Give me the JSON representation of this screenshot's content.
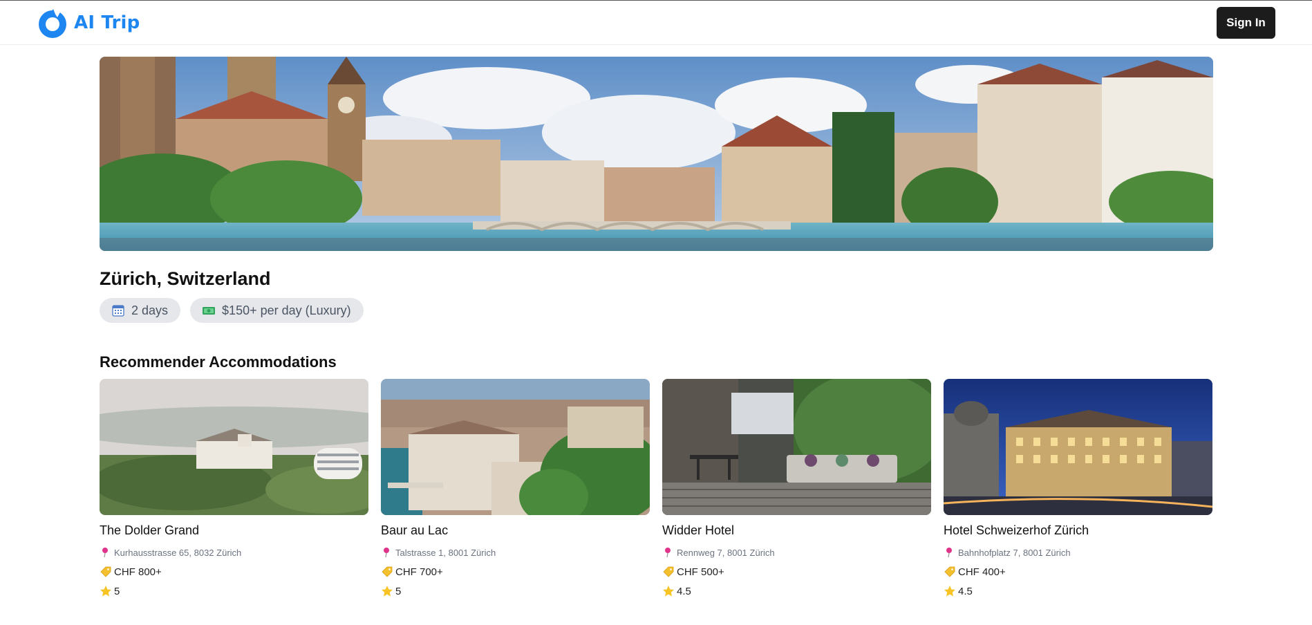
{
  "app": {
    "name": "AI Trip",
    "accent": "#1e86f0",
    "signin_label": "Sign In"
  },
  "destination": {
    "title": "Zürich, Switzerland",
    "duration": "2 days",
    "budget": "$150+ per day (Luxury)"
  },
  "accommodations": {
    "heading": "Recommender Accommodations",
    "items": [
      {
        "name": "The Dolder Grand",
        "address": "Kurhausstrasse 65, 8032 Zürich",
        "price": "CHF 800+",
        "rating": "5"
      },
      {
        "name": "Baur au Lac",
        "address": "Talstrasse 1, 8001 Zürich",
        "price": "CHF 700+",
        "rating": "5"
      },
      {
        "name": "Widder Hotel",
        "address": "Rennweg 7, 8001 Zürich",
        "price": "CHF 500+",
        "rating": "4.5"
      },
      {
        "name": "Hotel Schweizerhof Zürich",
        "address": "Bahnhofplatz 7, 8001 Zürich",
        "price": "CHF 400+",
        "rating": "4.5"
      }
    ]
  },
  "icons": {
    "logo": "refresh-drop-icon",
    "duration": "calendar-icon",
    "budget": "money-icon",
    "address": "pin-icon",
    "price": "tag-icon",
    "rating": "star-icon"
  }
}
